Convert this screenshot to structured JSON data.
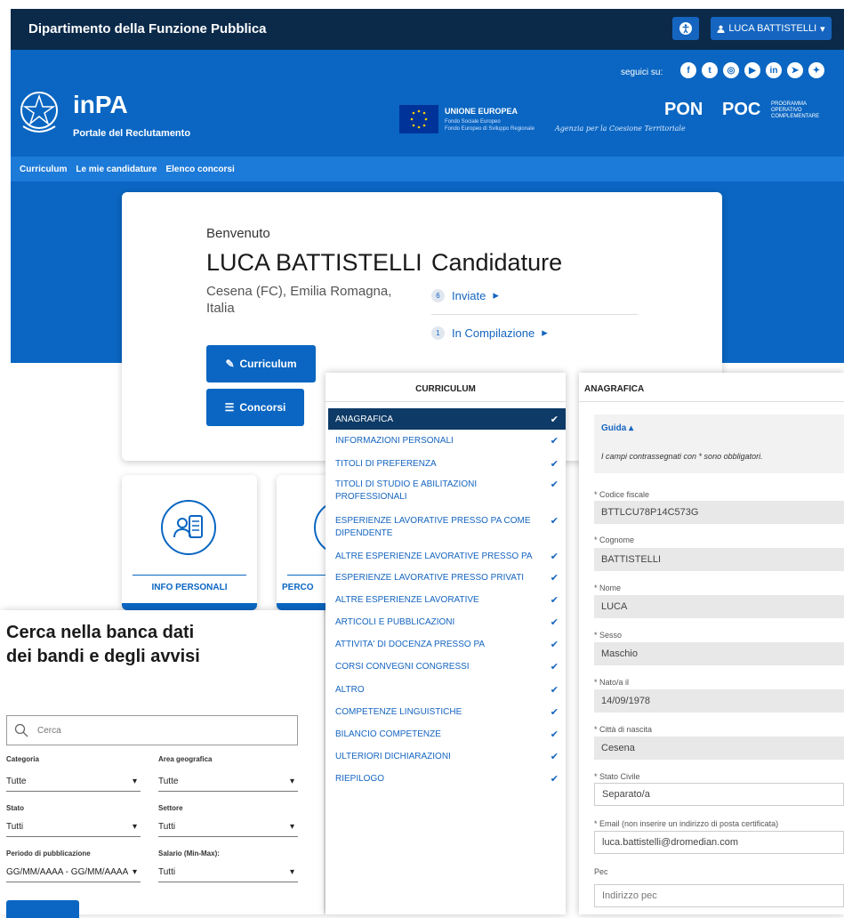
{
  "topbar": {
    "department": "Dipartimento della Funzione Pubblica",
    "user_button": "LUCA BATTISTELLI"
  },
  "hero": {
    "follow_label": "seguici su:",
    "socials": [
      "facebook-icon",
      "twitter-icon",
      "instagram-icon",
      "youtube-icon",
      "linkedin-icon",
      "telegram-icon",
      "extra-social-icon"
    ],
    "brand_title": "inPA",
    "brand_subtitle": "Portale del Reclutamento",
    "eu_title": "UNIONE EUROPEA",
    "eu_line1": "Fondo Sociale Europeo",
    "eu_line2": "Fondo Europeo di Sviluppo Regionale",
    "agency": "Agenzia per la Coesione Territoriale",
    "pon_logo": "PON",
    "poc_logo": "POC",
    "poc_text": [
      "PROGRAMMA",
      "OPERATIVO",
      "COMPLEMENTARE"
    ]
  },
  "nav": {
    "items": [
      "Curriculum",
      "Le mie candidature",
      "Elenco concorsi"
    ]
  },
  "welcome": {
    "greeting": "Benvenuto",
    "name": "LUCA BATTISTELLI",
    "location": "Cesena (FC), Emilia Romagna, Italia",
    "candidature_title": "Candidature",
    "sent_count": "6",
    "sent_label": "Inviate",
    "draft_count": "1",
    "draft_label": "In Compilazione",
    "curriculum_button": "Curriculum",
    "concorsi_button": "Concorsi"
  },
  "tiles": {
    "info_label": "INFO PERSONALI",
    "perc_label": "PERCO"
  },
  "search": {
    "title_line1": "Cerca nella banca dati",
    "title_line2": "dei bandi e degli avvisi",
    "placeholder": "Cerca",
    "categoria_label": "Categoria",
    "categoria_value": "Tutte",
    "area_label": "Area geografica",
    "area_value": "Tutte",
    "stato_label": "Stato",
    "stato_value": "Tutti",
    "settore_label": "Settore",
    "settore_value": "Tutti",
    "periodo_label": "Periodo di pubblicazione",
    "periodo_value": "GG/MM/AAAA - GG/MM/AAAA",
    "salario_label": "Salario (Min-Max):",
    "salario_value": "Tutti"
  },
  "curriculum": {
    "header": "CURRICULUM",
    "items": [
      "ANAGRAFICA",
      "INFORMAZIONI PERSONALI",
      "TITOLI DI PREFERENZA",
      "TITOLI DI STUDIO E ABILITAZIONI PROFESSIONALI",
      "ESPERIENZE LAVORATIVE PRESSO PA COME DIPENDENTE",
      "ALTRE ESPERIENZE LAVORATIVE PRESSO PA",
      "ESPERIENZE LAVORATIVE PRESSO PRIVATI",
      "ALTRE ESPERIENZE LAVORATIVE",
      "ARTICOLI E PUBBLICAZIONI",
      "ATTIVITA' DI DOCENZA PRESSO PA",
      "CORSI CONVEGNI CONGRESSI",
      "ALTRO",
      "COMPETENZE LINGUISTICHE",
      "BILANCIO COMPETENZE",
      "ULTERIORI DICHIARAZIONI",
      "RIEPILOGO"
    ]
  },
  "anagrafica": {
    "header": "ANAGRAFICA",
    "guida_label": "Guida",
    "guida_text": "I campi contrassegnati con * sono obbligatori.",
    "codice_fiscale_label": "* Codice fiscale",
    "codice_fiscale": "BTTLCU78P14C573G",
    "cognome_label": "* Cognome",
    "cognome": "BATTISTELLI",
    "nome_label": "* Nome",
    "nome": "LUCA",
    "sesso_label": "* Sesso",
    "sesso": "Maschio",
    "nascita_label": "* Nato/a il",
    "nascita": "14/09/1978",
    "citta_label": "* Città di nascita",
    "citta": "Cesena",
    "stato_civile_label": "* Stato Civile",
    "stato_civile": "Separato/a",
    "email_label": "* Email (non inserire un indirizzo di posta certificata)",
    "email": "luca.battistelli@dromedian.com",
    "pec_label": "Pec",
    "pec_placeholder": "Indirizzo pec"
  },
  "colors": {
    "dark_navy": "#0b2a4a",
    "brand_blue": "#0a66c2",
    "active_item": "#0d3a66"
  }
}
